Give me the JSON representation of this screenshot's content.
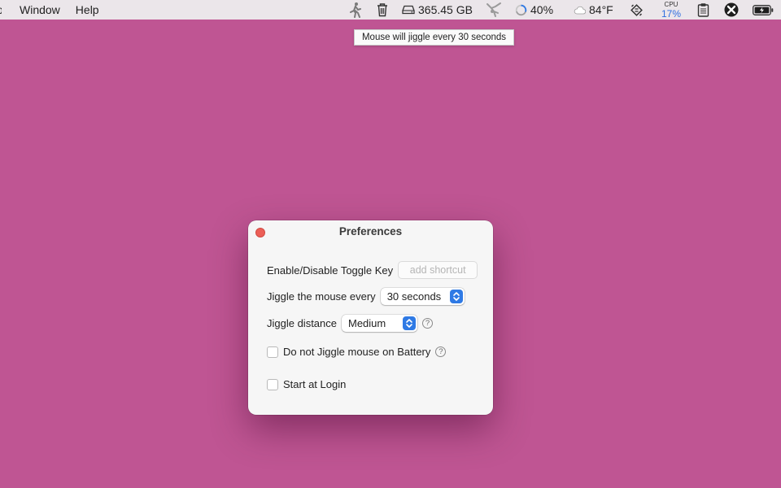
{
  "menubar": {
    "menus": [
      {
        "label": "Window"
      },
      {
        "label": "Help"
      }
    ],
    "cut_menu": "o",
    "status": {
      "disk_free": "365.45 GB",
      "cpu_circle_percent": "40%",
      "weather_temp": "84°F",
      "cpu_label": "CPU",
      "cpu_percent": "17%"
    }
  },
  "tooltip": {
    "text": "Mouse will jiggle every 30 seconds"
  },
  "window": {
    "title": "Preferences",
    "toggle_key": {
      "label": "Enable/Disable Toggle Key",
      "placeholder": "add shortcut"
    },
    "jiggle_every": {
      "label": "Jiggle the mouse every",
      "value": "30 seconds"
    },
    "jiggle_distance": {
      "label": "Jiggle distance",
      "value": "Medium"
    },
    "battery_option": {
      "label": "Do not Jiggle mouse on Battery",
      "checked": false
    },
    "login_option": {
      "label": "Start at Login",
      "checked": false
    },
    "help_glyph": "?"
  },
  "colors": {
    "desktop": "#BF5593",
    "close_button": "#ec5f57",
    "accent": "#2f7ae5",
    "cpu_percent": "#2f6fe0"
  }
}
